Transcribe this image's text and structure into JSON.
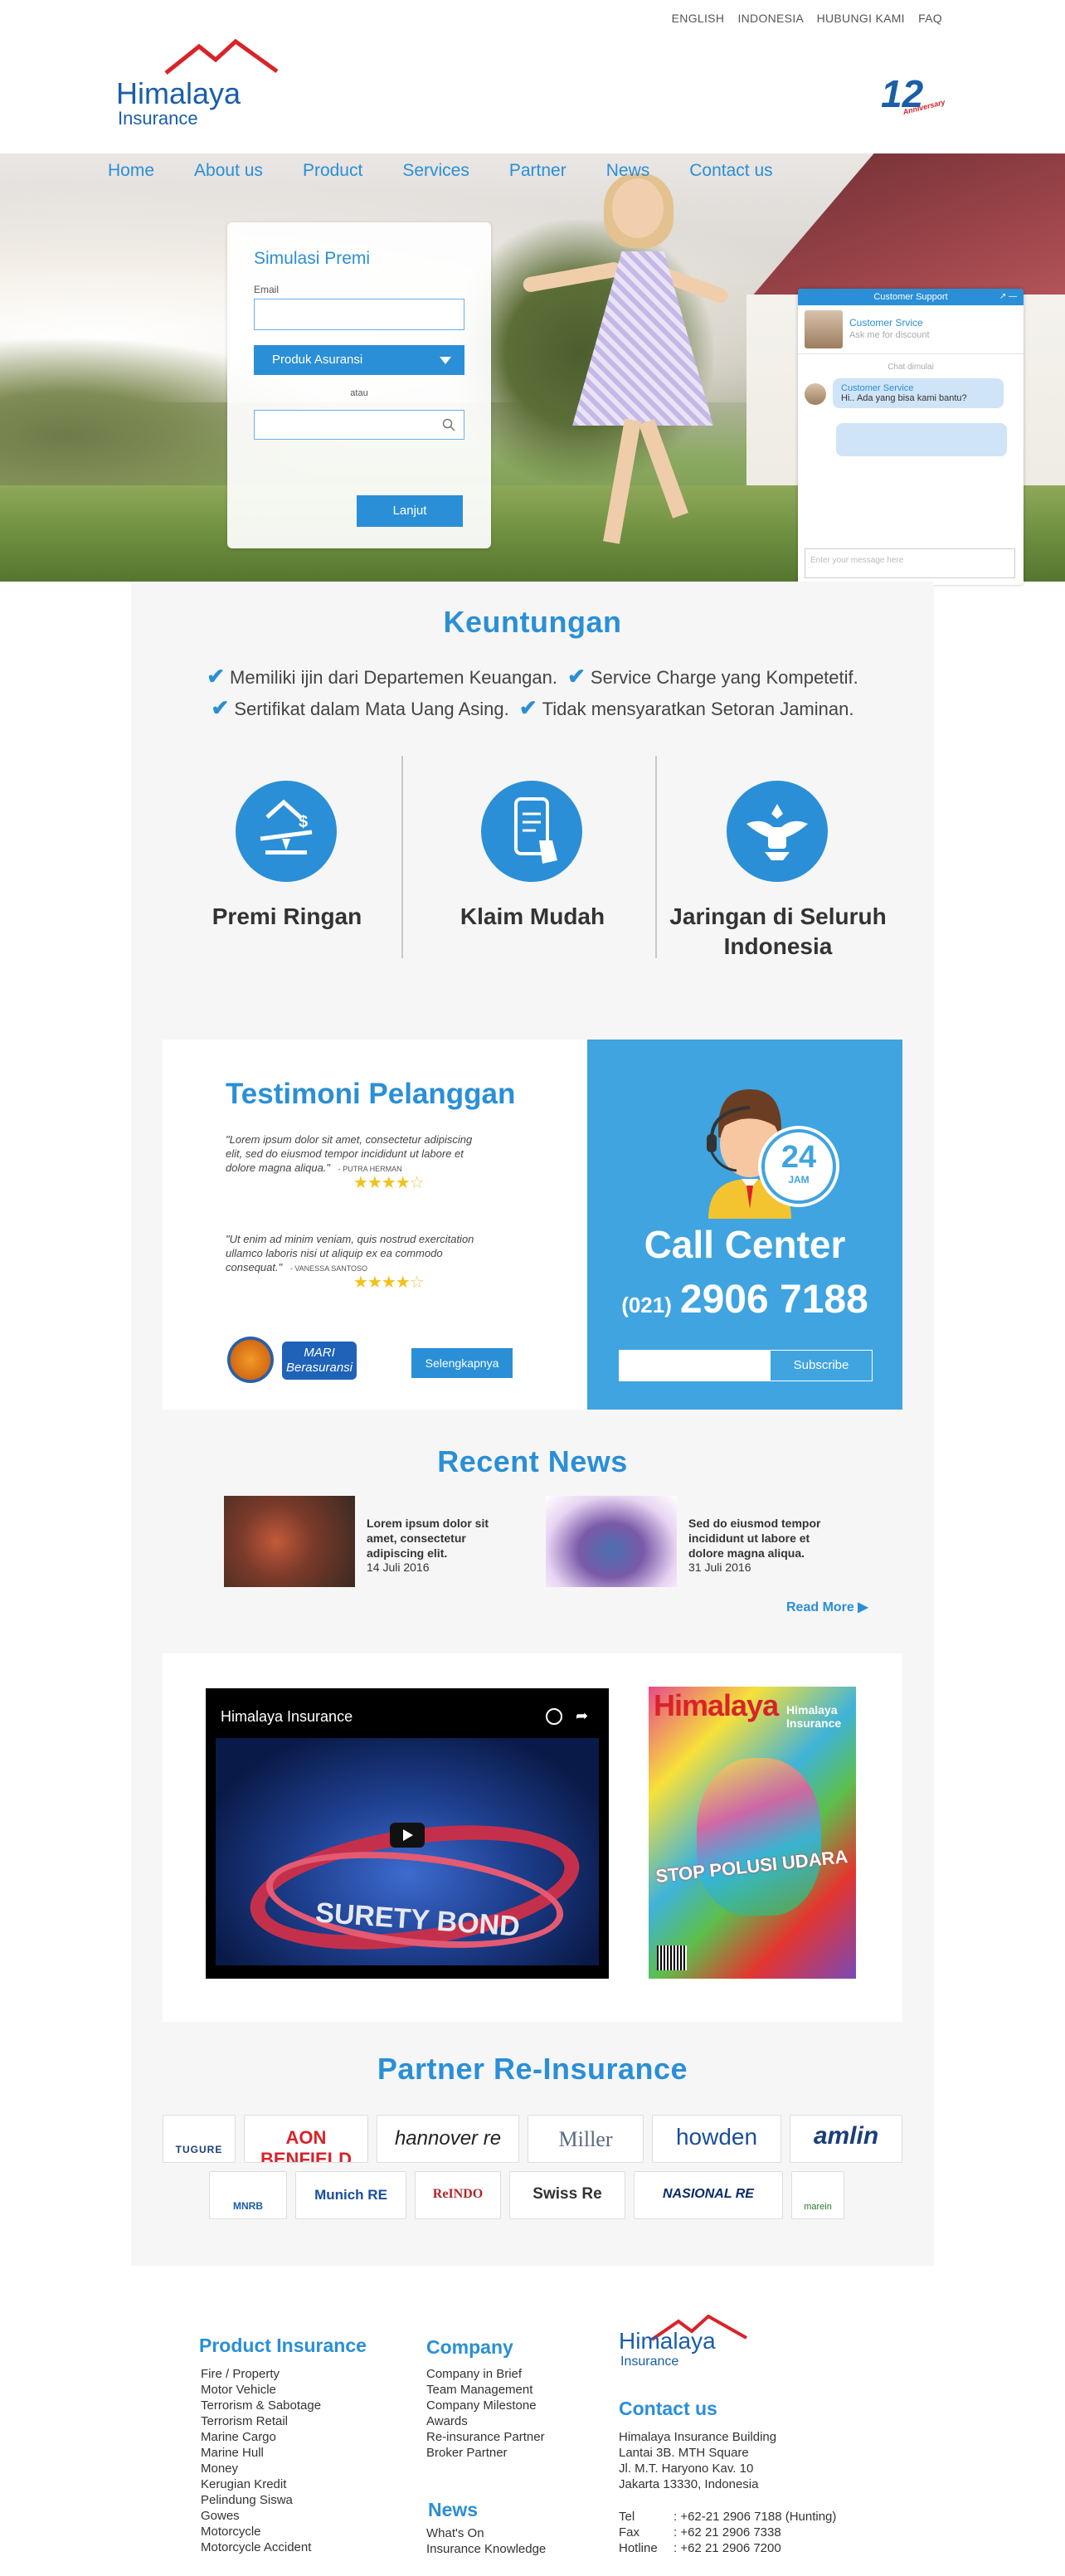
{
  "topbar": {
    "english": "ENGLISH",
    "indonesia": "INDONESIA",
    "contact": "HUBUNGI KAMI",
    "faq": "FAQ"
  },
  "brand": {
    "name": "Himalaya",
    "sub": "Insurance",
    "anniversary": "12",
    "anniversary_word": "Anniversary"
  },
  "nav": [
    "Home",
    "About us",
    "Product",
    "Services",
    "Partner",
    "News",
    "Contact us"
  ],
  "simulasi": {
    "title": "Simulasi Premi",
    "email_label": "Email",
    "product_select": "Produk Asuransi",
    "or": "atau",
    "submit": "Lanjut"
  },
  "chat": {
    "header": "Customer Support",
    "agent_name": "Customer Srvice",
    "agent_status": "Ask me for discount",
    "started": "Chat dimulai",
    "msg_name": "Customer Service",
    "msg_text": "Hi.. Ada yang bisa kami bantu?",
    "input_placeholder": "Enter your message here"
  },
  "keuntungan": {
    "title": "Keuntungan",
    "benefits": [
      "Memiliki ijin dari Departemen Keuangan.",
      "Service Charge yang Kompetetif.",
      "Sertifikat dalam Mata Uang Asing.",
      "Tidak mensyaratkan Setoran Jaminan."
    ],
    "features": [
      {
        "label": "Premi Ringan",
        "icon": "scale-icon"
      },
      {
        "label": "Klaim Mudah",
        "icon": "phone-tap-icon"
      },
      {
        "label": "Jaringan di Seluruh Indonesia",
        "icon": "garuda-icon"
      }
    ]
  },
  "testimoni": {
    "title": "Testimoni Pelanggan",
    "items": [
      {
        "text": "\"Lorem ipsum dolor sit amet, consectetur adipiscing elit, sed do eiusmod tempor incididunt ut labore et dolore magna aliqua.\"",
        "author": "- PUTRA HERMAN",
        "stars": 4
      },
      {
        "text": "\"Ut enim ad minim veniam, quis nostrud exercitation ullamco laboris nisi ut aliquip ex ea commodo consequat.\"",
        "author": "- VANESSA SANTOSO",
        "stars": 4
      }
    ],
    "logo_b": "MARI Berasuransi",
    "more": "Selengkapnya"
  },
  "callcenter": {
    "badge_number": "24",
    "badge_word": "JAM",
    "title": "Call Center",
    "area": "(021)",
    "phone": "2906 7188",
    "subscribe": "Subscribe"
  },
  "news": {
    "title": "Recent News",
    "items": [
      {
        "title": "Lorem ipsum dolor sit amet, consectetur adipiscing elit.",
        "date": "14 Juli 2016"
      },
      {
        "title": "Sed do eiusmod tempor incididunt ut labore et dolore magna aliqua.",
        "date": "31 Juli 2016"
      }
    ],
    "more": "Read More"
  },
  "media": {
    "video_title": "Himalaya Insurance",
    "video_word": "SURETY BOND",
    "magazine_title": "Himalaya",
    "magazine_brand": "Himalaya Insurance",
    "magazine_cover": "STOP POLUSI UDARA"
  },
  "partners": {
    "title": "Partner Re-Insurance",
    "row1": [
      "TUGURE",
      "AON BENFIELD",
      "hannover re",
      "Miller",
      "howden",
      "amlin"
    ],
    "row2": [
      "MNRB",
      "Munich RE",
      "ReINDO",
      "Swiss Re",
      "NASIONAL RE",
      "marein"
    ]
  },
  "footer": {
    "product_title": "Product Insurance",
    "products": [
      "Fire / Property",
      "Motor Vehicle",
      "Terrorism & Sabotage",
      "Terrorism Retail",
      "Marine Cargo",
      "Marine Hull",
      "Money",
      "Kerugian Kredit",
      "Pelindung Siswa",
      "Gowes",
      "Motorcycle",
      "Motorcycle Accident"
    ],
    "company_title": "Company",
    "company": [
      "Company in Brief",
      "Team Management",
      "Company Milestone",
      "Awards",
      "Re-insurance Partner",
      "Broker Partner"
    ],
    "news_title": "News",
    "news": [
      "What's On",
      "Insurance Knowledge"
    ],
    "contact_title": "Contact us",
    "address": [
      "Himalaya Insurance Building",
      "Lantai 3B. MTH Square",
      "Jl. M.T. Haryono Kav. 10",
      "Jakarta 13330, Indonesia"
    ],
    "tel_label": "Tel",
    "tel": ": +62-21 2906 7188 (Hunting)",
    "fax_label": "Fax",
    "fax": ": +62 21 2906 7338",
    "hotline_label": "Hotline",
    "hotline": ": +62 21 2906 7200"
  },
  "colors": {
    "primary": "#2a8fd6",
    "call_center_bg": "#3fa4e0",
    "section_bg": "#f6f6f6"
  }
}
